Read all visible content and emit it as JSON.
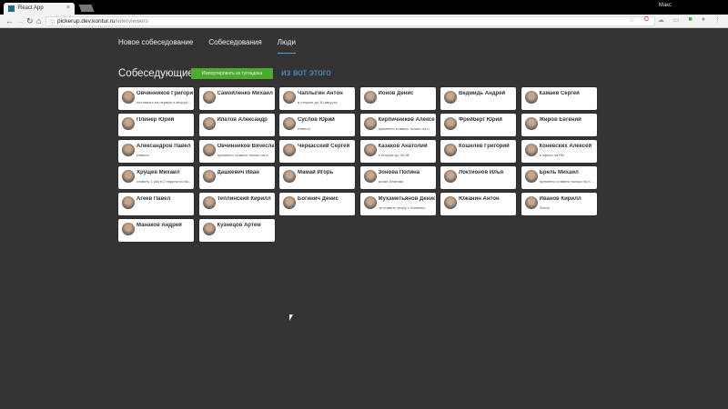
{
  "browser": {
    "tab_title": "React App",
    "user": "Макс",
    "url_host": "pickerup.dev.kontur.ru",
    "url_path": "/interviewers"
  },
  "nav": {
    "items": [
      "Новое собеседование",
      "Собеседования",
      "Люди"
    ],
    "active": 2
  },
  "page": {
    "title": "Собеседующие",
    "import_button": "Импортировать из гугладока",
    "link": "из вот этого"
  },
  "people": [
    {
      "name": "Овчинников Григорий",
      "note": "поставить на первую и вторую ..."
    },
    {
      "name": "Самойленко Михаил",
      "note": ""
    },
    {
      "name": "Чаплыгин Антон",
      "note": "в отпуске до 30 августа"
    },
    {
      "name": "Ионов Денис",
      "note": ""
    },
    {
      "name": "Ведмидь Андрей",
      "note": ""
    },
    {
      "name": "Камаев Сергей",
      "note": ""
    },
    {
      "name": "Плинер Юрий",
      "note": ""
    },
    {
      "name": "Ипатов Александр",
      "note": ""
    },
    {
      "name": "Суслов Юрий",
      "note": "Инвеон"
    },
    {
      "name": "Кирпичников Алексей",
      "note": "временно ставить только на н..."
    },
    {
      "name": "Фрейберг Юрий",
      "note": ""
    },
    {
      "name": "Жиров Евгений",
      "note": ""
    },
    {
      "name": "Александров Павел",
      "note": "Инвеон"
    },
    {
      "name": "Овчинников Вячеслав",
      "note": "временно ставить только на н..."
    },
    {
      "name": "Черкасский Сергей",
      "note": ""
    },
    {
      "name": "Казаков Анатолий",
      "note": "в отпуске до 30.08"
    },
    {
      "name": "Кошелев Григорий",
      "note": ""
    },
    {
      "name": "Коневских Алексей",
      "note": "в офисе на НВ"
    },
    {
      "name": "Хрущев Михаил",
      "note": "ставить 1 раз в 2 недели по во..."
    },
    {
      "name": "Дашкевич Иван",
      "note": ""
    },
    {
      "name": "Мамай Игорь",
      "note": ""
    },
    {
      "name": "Зонова Полина",
      "note": "кроме Ипатова"
    },
    {
      "name": "Локтионов Илья",
      "note": ""
    },
    {
      "name": "Брель Михаил",
      "note": "временно ставить только на н..."
    },
    {
      "name": "Агеев Павел",
      "note": ""
    },
    {
      "name": "Теплинский Кирилл",
      "note": ""
    },
    {
      "name": "Богинич Денис",
      "note": ""
    },
    {
      "name": "Мухаметьянов Денис",
      "note": "не ставить втору с Фоменко"
    },
    {
      "name": "Южанин Антон",
      "note": ""
    },
    {
      "name": "Иванов Кирилл",
      "note": "Питер"
    },
    {
      "name": "Манаков Андрей",
      "note": ""
    },
    {
      "name": "Кузнецов Артем",
      "note": ""
    }
  ],
  "colors": {
    "background": "#353334",
    "accent": "#4d9be0",
    "import_button": "#4caa2c"
  }
}
